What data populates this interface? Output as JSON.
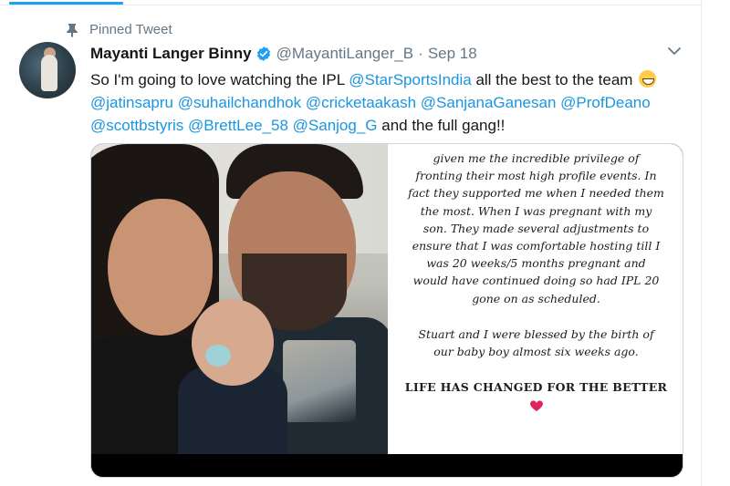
{
  "pinned": {
    "label": "Pinned Tweet"
  },
  "tweet": {
    "display_name": "Mayanti Langer Binny",
    "handle": "@MayantiLanger_B",
    "separator": "·",
    "date": "Sep 18",
    "text_intro": "So I'm going to love watching the IPL ",
    "mention_1": "@StarSportsIndia",
    "text_mid": " all the best to the team ",
    "mentions": [
      "@jatinsapru",
      "@suhailchandhok",
      "@cricketaakash",
      "@SanjanaGanesan",
      "@ProfDeano",
      "@scottbstyris",
      "@BrettLee_58",
      "@Sanjog_G"
    ],
    "text_outro": " and the full gang!!"
  },
  "note": {
    "lines": [
      "given me the incredible privilege of",
      "fronting their most high profile events. In",
      "fact they supported me when I needed them",
      "the most. When I was pregnant with my",
      "son. They made several adjustments to",
      "ensure that I was comfortable hosting till I",
      "was 20 weeks/5 months pregnant and",
      "would have continued doing so had IPL 20",
      "gone on as scheduled."
    ],
    "lines_2": [
      "Stuart and I were blessed by the birth of",
      "our baby boy almost six weeks ago."
    ],
    "closing": "LIFE HAS CHANGED FOR THE BETTER"
  },
  "colors": {
    "link": "#1b95e0",
    "accent": "#1da1f2",
    "muted": "#657786",
    "heart": "#e0245e"
  },
  "icons": {
    "pin": "pin-icon",
    "verified": "verified-badge-icon",
    "chevron": "chevron-down-icon",
    "emoji": "grinning-face-emoji",
    "heart": "red-heart-emoji"
  }
}
